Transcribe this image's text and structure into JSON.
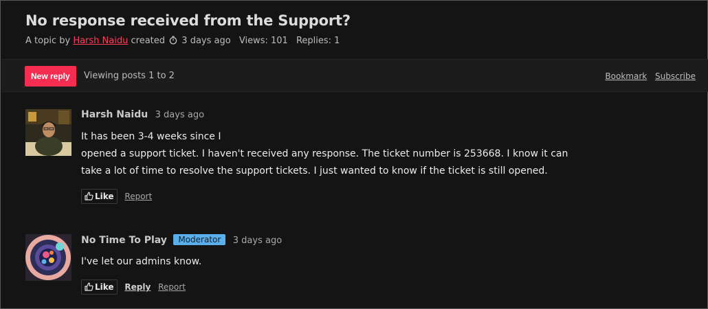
{
  "topic": {
    "title": "No response received from the Support?",
    "meta_prefix": "A topic by",
    "author": "Harsh Naidu",
    "created_label": "created",
    "created_ago": "3 days ago",
    "views": "Views: 101",
    "replies": "Replies: 1"
  },
  "toolbar": {
    "new_reply": "New reply",
    "viewing": "Viewing posts 1 to 2",
    "bookmark": "Bookmark",
    "subscribe": "Subscribe"
  },
  "posts": [
    {
      "author": "Harsh Naidu",
      "time": "3 days ago",
      "lines": [
        "It has been 3-4 weeks since I",
        "opened a support ticket. I haven't received any response. The ticket number is 253668. I know it can",
        "take a lot of time to resolve the support tickets. I just wanted to know if the ticket is still opened."
      ],
      "like": "Like",
      "report": "Report"
    },
    {
      "author": "No Time To Play",
      "badge": "Moderator",
      "time": "3 days ago",
      "lines": [
        "I've let our admins know."
      ],
      "like": "Like",
      "reply": "Reply",
      "report": "Report"
    }
  ],
  "colors": {
    "accent": "#f52d51",
    "link": "#ff3b5c",
    "badge": "#5aaeea"
  },
  "icons": {
    "clock": "stopwatch-icon",
    "like": "thumbs-up-icon"
  }
}
